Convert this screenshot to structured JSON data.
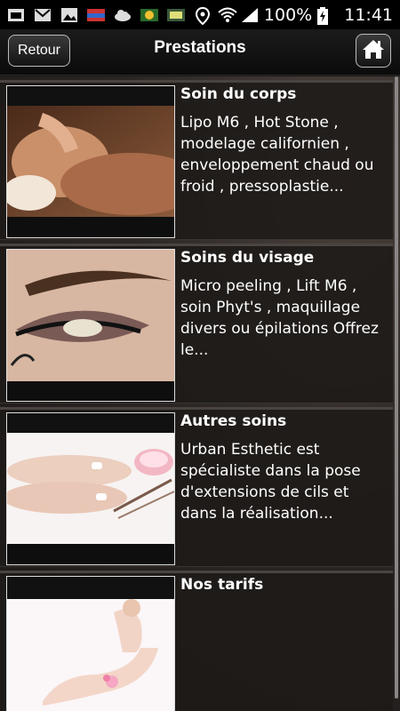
{
  "status_bar": {
    "battery_text": "100%",
    "time": "11:41",
    "icons": [
      "mail-icon",
      "gmail-icon",
      "image-icon",
      "flag-icon",
      "cloud-icon",
      "app-icon",
      "app-icon",
      "location-icon",
      "wifi-icon",
      "signal-icon",
      "battery-charging-icon"
    ]
  },
  "header": {
    "back_label": "Retour",
    "title": "Prestations",
    "home_icon": "home-icon"
  },
  "items": [
    {
      "title": "Soin du corps",
      "description": "Lipo M6 , Hot Stone , modelage californien , enveloppement chaud ou froid , pressoplastie..."
    },
    {
      "title": "Soins du visage",
      "description": "Micro peeling , Lift M6 , soin Phyt's , maquillage divers ou épilations Offrez le..."
    },
    {
      "title": "Autres soins",
      "description": "Urban Esthetic est spécialiste dans la pose d'extensions de cils et dans la réalisation..."
    },
    {
      "title": "Nos tarifs",
      "description": ""
    }
  ]
}
